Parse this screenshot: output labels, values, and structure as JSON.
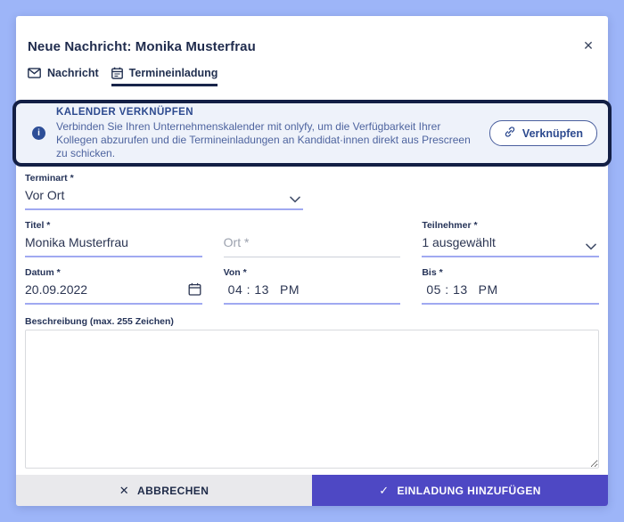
{
  "window": {
    "title": "Neue Nachricht: Monika Musterfrau"
  },
  "icons": {
    "close": "✕",
    "cancel_x": "✕",
    "check": "✓",
    "info": "i"
  },
  "tabs": {
    "nachricht": "Nachricht",
    "termineinladung": "Termineinladung"
  },
  "banner": {
    "heading": "KALENDER VERKNÜPFEN",
    "body": "Verbinden Sie Ihren Unternehmenskalender mit onlyfy, um die Verfügbarkeit Ihrer Kollegen abzurufen und die Termineinladungen an Kandidat·innen direkt aus Prescreen zu schicken.",
    "link_button": "Verknüpfen"
  },
  "form": {
    "terminart": {
      "label": "Terminart *",
      "value": "Vor Ort"
    },
    "titel": {
      "label": "Titel *",
      "value": "Monika Musterfrau"
    },
    "ort": {
      "placeholder": "Ort *"
    },
    "teilnehmer": {
      "label": "Teilnehmer *",
      "value": "1 ausgewählt"
    },
    "datum": {
      "label": "Datum *",
      "value": "20.09.2022"
    },
    "von": {
      "label": "Von *",
      "time": "04 : 13",
      "meridiem": "PM"
    },
    "bis": {
      "label": "Bis *",
      "time": "05 : 13",
      "meridiem": "PM"
    },
    "beschreibung": {
      "label": "Beschreibung (max. 255 Zeichen)",
      "value": ""
    }
  },
  "footer": {
    "cancel": "ABBRECHEN",
    "submit": "EINLADUNG HINZUFÜGEN"
  },
  "colors": {
    "page_bg": "#9db5f8",
    "accent_indigo": "#4e48c4",
    "highlight_border": "#131f45",
    "banner_bg": "#eef2fa",
    "banner_blue": "#2d4a8f",
    "underline_purple": "#a0a9f1",
    "underline_gray": "#ccd0d9"
  }
}
